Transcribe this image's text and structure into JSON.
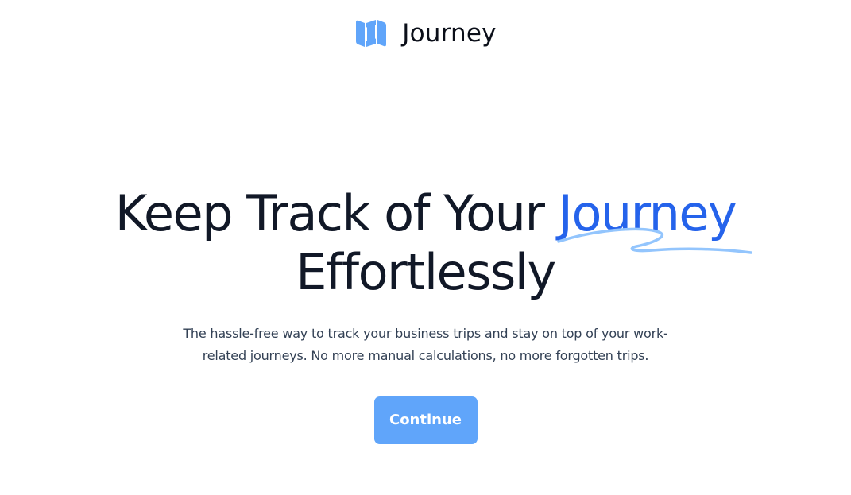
{
  "brand": {
    "name": "Journey",
    "icon": "map-icon",
    "icon_color": "#60a5fa"
  },
  "hero": {
    "headline_part1": "Keep Track of Your ",
    "headline_highlight": "Journey",
    "headline_part2": "Effortlessly",
    "highlight_color": "#2563eb",
    "underline_color": "#93c5fd",
    "subtitle": "The hassle-free way to track your business trips and stay on top of your work-related journeys. No more manual calculations, no more forgotten trips."
  },
  "cta": {
    "continue_label": "Continue",
    "color": "#60a5fa"
  }
}
